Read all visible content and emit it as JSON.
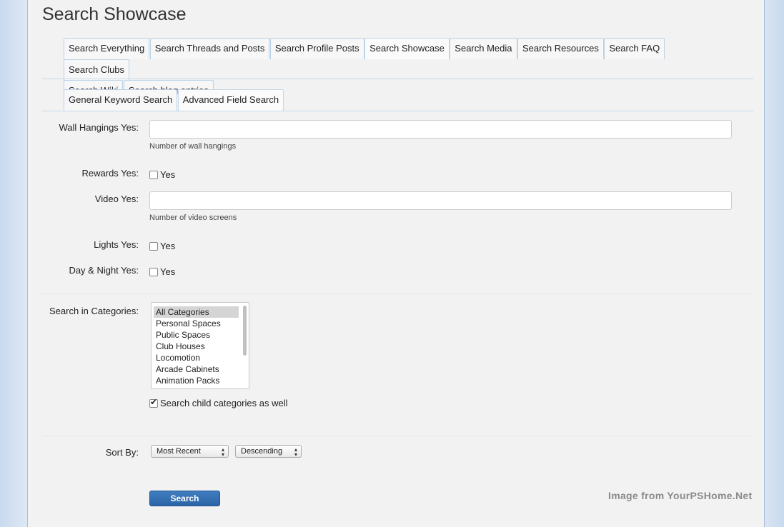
{
  "page_title": "Search Showcase",
  "search_tabs": [
    "Search Everything",
    "Search Threads and Posts",
    "Search Profile Posts",
    "Search Showcase",
    "Search Media",
    "Search Resources",
    "Search FAQ",
    "Search Clubs",
    "Search Wiki",
    "Search blog entries"
  ],
  "sub_tabs": [
    "General Keyword Search",
    "Advanced Field Search"
  ],
  "fields": {
    "wall_hangings": {
      "label": "Wall Hangings Yes:",
      "value": "",
      "hint": "Number of wall hangings"
    },
    "rewards": {
      "label": "Rewards Yes:",
      "option": "Yes",
      "checked": false
    },
    "video": {
      "label": "Video Yes:",
      "value": "",
      "hint": "Number of video screens"
    },
    "lights": {
      "label": "Lights Yes:",
      "option": "Yes",
      "checked": false
    },
    "day_night": {
      "label": "Day & Night Yes:",
      "option": "Yes",
      "checked": false
    }
  },
  "categories": {
    "label": "Search in Categories:",
    "options": [
      "All Categories",
      "Personal Spaces",
      "Public Spaces",
      "Club Houses",
      "Locomotion",
      "Arcade Cabinets",
      "Animation Packs"
    ],
    "selected": "All Categories",
    "child_label": "Search child categories as well",
    "child_checked": true
  },
  "sort": {
    "label": "Sort By:",
    "order_by": "Most Recent",
    "direction": "Descending"
  },
  "search_button": "Search",
  "watermark": "Image from YourPSHome.Net"
}
